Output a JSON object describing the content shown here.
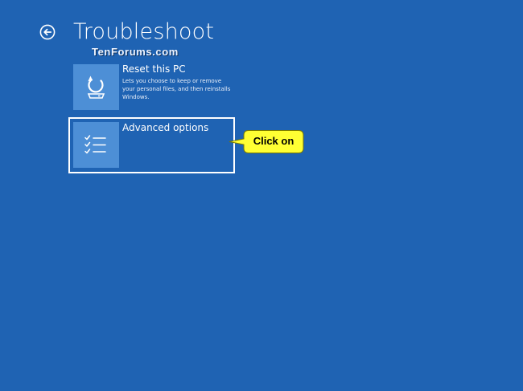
{
  "header": {
    "title": "Troubleshoot",
    "back_icon": "arrow-left-circle-icon"
  },
  "watermark": "TenForums.com",
  "options": [
    {
      "title": "Reset this PC",
      "description": "Lets you choose to keep or remove your personal files, and then reinstalls Windows.",
      "icon": "refresh-drive-icon"
    },
    {
      "title": "Advanced options",
      "icon": "checklist-icon"
    }
  ],
  "callout": {
    "text": "Click on",
    "color": "#ffff33"
  },
  "colors": {
    "background": "#1f63b3",
    "tile": "#4d8fd6",
    "text": "#ffffff"
  }
}
